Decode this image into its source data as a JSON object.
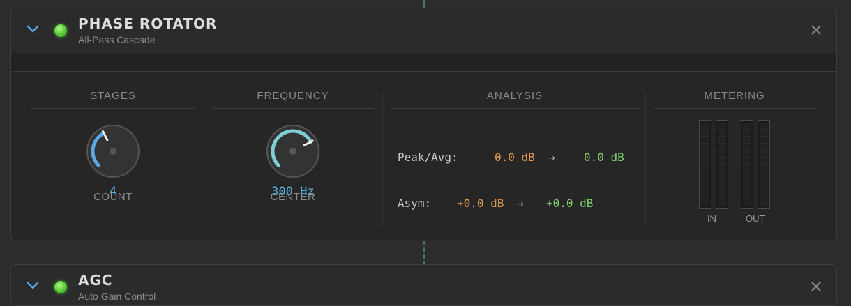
{
  "panels": [
    {
      "title": "PHASE ROTATOR",
      "subtitle": "All-Pass Cascade",
      "sections": {
        "stages": {
          "title": "STAGES",
          "knob_label": "COUNT",
          "knob_value": "4",
          "fraction": 0.4
        },
        "frequency": {
          "title": "FREQUENCY",
          "knob_label": "CENTER",
          "knob_value": "300 Hz",
          "fraction": 0.73
        },
        "analysis": {
          "title": "ANALYSIS",
          "rows": [
            {
              "label": "Peak/Avg:",
              "in": "0.0 dB",
              "arrow": "→",
              "out": "0.0 dB"
            },
            {
              "label": "Asym:",
              "in": "+0.0 dB",
              "arrow": "→",
              "out": "+0.0 dB"
            }
          ]
        },
        "metering": {
          "title": "METERING",
          "in_label": "IN",
          "out_label": "OUT"
        }
      }
    },
    {
      "title": "AGC",
      "subtitle": "Auto Gain Control"
    }
  ],
  "colors": {
    "accent_blue": "#5aa9e6",
    "led_green": "#5fd33d",
    "value_orange": "#e09a4e",
    "value_green": "#7fcf6c",
    "freq_arc": "#7fcfd6"
  }
}
